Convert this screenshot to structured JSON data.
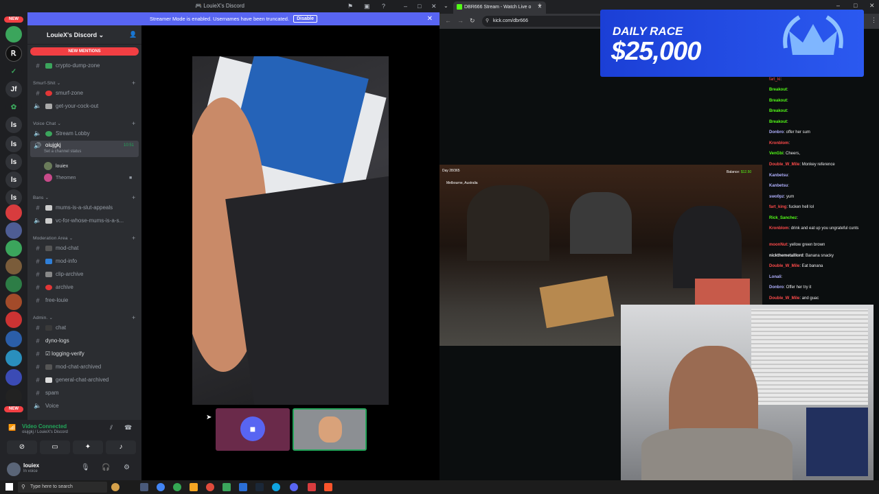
{
  "discord": {
    "title": "LouieX's Discord",
    "banner": {
      "text": "Streamer Mode is enabled. Usernames have been truncated.",
      "button": "Disable"
    },
    "server_name": "LouieX's Discord",
    "new_mentions": "NEW MENTIONS",
    "rail_badges": [
      "NEW",
      "NEW"
    ],
    "rail_letters": [
      "Jf",
      "ls",
      "ls",
      "ls",
      "ls",
      "ls"
    ],
    "categories": [
      {
        "label": "Smurf-Shit"
      },
      {
        "label": "Voice Chat"
      },
      {
        "label": "Bans"
      },
      {
        "label": "Moderation Area"
      },
      {
        "label": "Admin."
      }
    ],
    "channels": {
      "crypto": "crypto-dump-zone",
      "smurf_zone": "smurf-zone",
      "get_cock": "get-your-cock-out",
      "stream_lobby": "Stream Lobby",
      "oiujgkj": "oiujgkj",
      "oiujgkj_time": "10:51",
      "set_status": "Set a channel status",
      "voice_user1": "louiex",
      "voice_user2": "Theomen",
      "mums_slut": "mums-is-a-slut-appeals",
      "vc_mums": "vc-for-whose-mums-is-a-s...",
      "mod_chat": "mod-chat",
      "mod_info": "mod-info",
      "clip_archive": "clip-archive",
      "archive": "archive",
      "free_louie": "free-louie",
      "chat": "chat",
      "dyno_logs": "dyno-logs",
      "logging_verify": "logging-verify",
      "mod_chat_archived": "mod-chat-archived",
      "general_chat_archived": "general-chat-archived",
      "spam": "spam",
      "voice": "Voice"
    },
    "voice_panel": {
      "status": "Video Connected",
      "sub": "oiujgkj / LouieX's Discord"
    },
    "user": {
      "name": "louiex",
      "status": "In voice"
    }
  },
  "taskbar": {
    "search_placeholder": "Type here to search"
  },
  "browser": {
    "tab_title": "DBR666 Stream - Watch Live o",
    "url": "kick.com/dbr666",
    "ad": {
      "line1": "DAILY RACE",
      "line2": "$25,000"
    },
    "stream_overlay": {
      "date": "Day 28/365",
      "place": "Melbourne, Australia",
      "balance_label": "Balance:",
      "balance": "$12.50"
    },
    "chat": [
      {
        "user": "fart_ki",
        "text": "",
        "color": "#ff4b4b"
      },
      {
        "user": "Breakout",
        "text": "",
        "color": "#53fc18"
      },
      {
        "user": "Breakout",
        "text": "",
        "color": "#53fc18"
      },
      {
        "user": "Breakout",
        "text": "",
        "color": "#53fc18"
      },
      {
        "user": "Breakout",
        "text": "",
        "color": "#53fc18"
      },
      {
        "user": "Donbro",
        "text": "offer her sum",
        "color": "#b1b1ff"
      },
      {
        "user": "Kronblom",
        "text": "",
        "color": "#ff4b4b"
      },
      {
        "user": "VenGbi",
        "text": "Cheers,",
        "color": "#53fc18"
      },
      {
        "user": "Double_W_Mile",
        "text": "Monkey reference",
        "color": "#ff4b4b"
      },
      {
        "user": "Kanbetsu",
        "text": "",
        "color": "#b1b1ff"
      },
      {
        "user": "Kanbetsu",
        "text": "",
        "color": "#b1b1ff"
      },
      {
        "user": "swo0pz",
        "text": "yum",
        "color": "#b1b1ff"
      },
      {
        "user": "fart_king",
        "text": "fucken hell lol",
        "color": "#ff4b4b"
      },
      {
        "user": "Rick_Sanchez",
        "text": "",
        "color": "#53fc18"
      },
      {
        "user": "Kronblom",
        "text": "drink and eat up you ungrateful cunts",
        "color": "#ff4b4b"
      },
      {
        "user": "moonNut",
        "text": "yellow green brown",
        "color": "#ff4b4b"
      },
      {
        "user": "nickthemetalllord",
        "text": "Banana snacky",
        "color": "#efeff1"
      },
      {
        "user": "Double_W_Mile",
        "text": "Eat banana",
        "color": "#ff4b4b"
      },
      {
        "user": "Lonali",
        "text": "",
        "color": "#b1b1ff"
      },
      {
        "user": "Donbro",
        "text": "Offer her try it",
        "color": "#b1b1ff"
      },
      {
        "user": "Double_W_Mile",
        "text": "and guac",
        "color": "#ff4b4b"
      }
    ]
  },
  "colors": {
    "discord_blurple": "#5865f2",
    "discord_red": "#f23f43",
    "discord_green": "#23a55a",
    "kick_green": "#53fc18"
  }
}
